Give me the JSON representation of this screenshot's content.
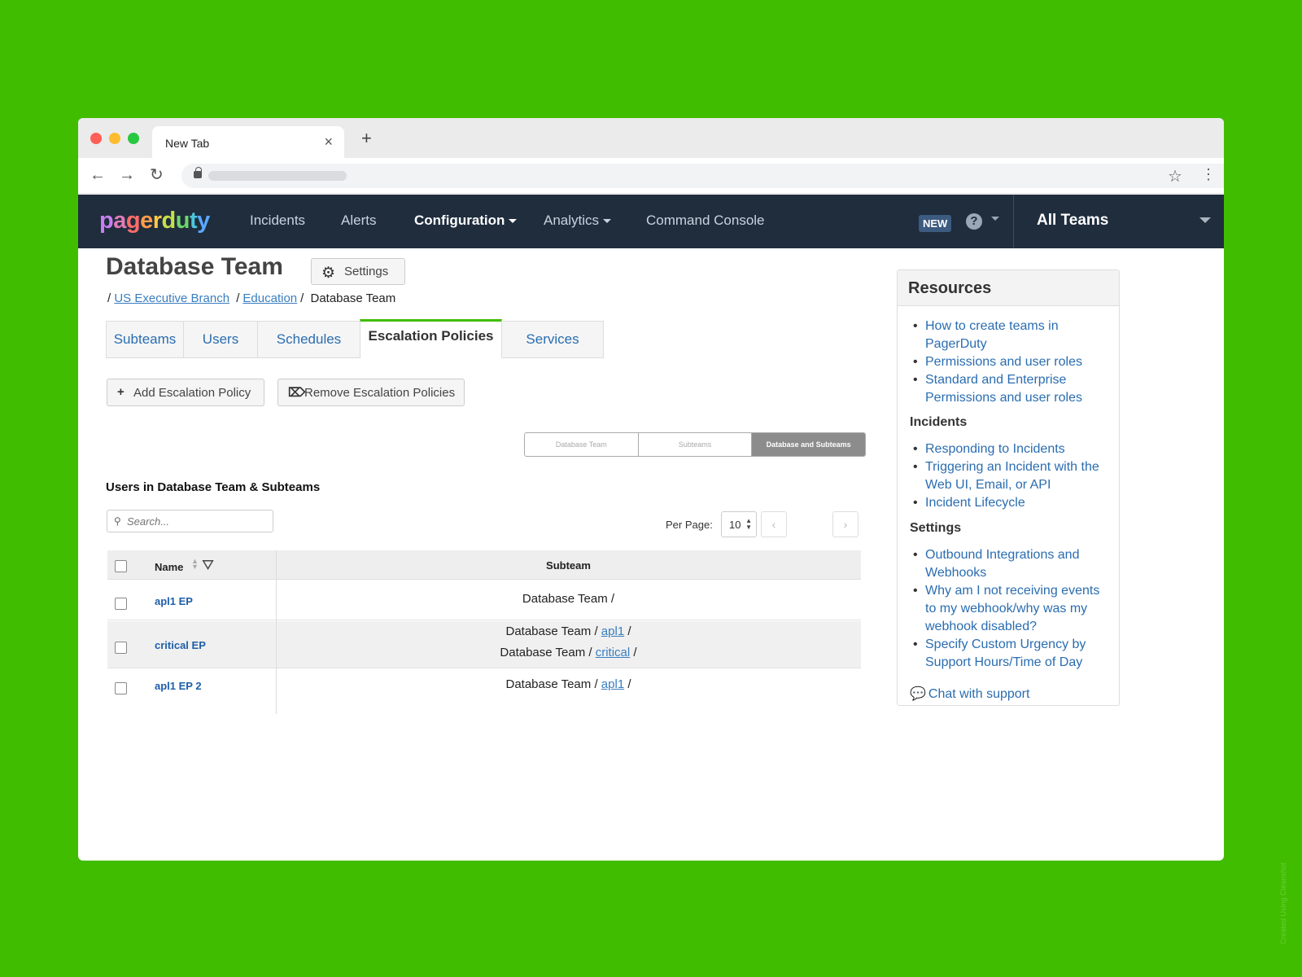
{
  "browser": {
    "tab_title": "New Tab",
    "close_glyph": "×",
    "new_tab_glyph": "+",
    "back_glyph": "←",
    "forward_glyph": "→",
    "reload_glyph": "↻",
    "star_glyph": "☆",
    "menu_glyph": "⋮"
  },
  "header": {
    "logo_letters": [
      "p",
      "a",
      "g",
      "e",
      "r",
      "d",
      "u",
      "t",
      "y"
    ],
    "nav": {
      "incidents": "Incidents",
      "alerts": "Alerts",
      "configuration": "Configuration",
      "analytics": "Analytics",
      "command_console": "Command Console"
    },
    "new_badge": "NEW",
    "help_glyph": "?",
    "teams_selector": "All Teams"
  },
  "page": {
    "title": "Database Team",
    "settings_label": "Settings",
    "settings_icon": "gear-icon",
    "breadcrumb": {
      "sep": "/",
      "item1": "US Executive Branch",
      "item2": "Education",
      "current": "Database Team"
    },
    "tabs": {
      "subteams": "Subteams",
      "users": "Users",
      "schedules": "Schedules",
      "escalation_policies": "Escalation Policies",
      "services": "Services"
    },
    "actions": {
      "add_icon": "+",
      "add_label": "Add Escalation Policy",
      "remove_label": "Remove Escalation Policies"
    },
    "scope": {
      "team": "Database Team",
      "subteams": "Subteams",
      "both": "Database and Subteams",
      "selected": "Database and Subteams"
    },
    "section_title": "Users in Database Team & Subteams",
    "search_placeholder": "Search...",
    "per_page_label": "Per Page:",
    "per_page_value": "10",
    "pager_prev": "‹",
    "pager_next": "›",
    "table": {
      "col_name": "Name",
      "col_subteam": "Subteam",
      "rows": [
        {
          "name": "apl1 EP",
          "lines": [
            {
              "team": "Database Team",
              "link": ""
            }
          ]
        },
        {
          "name": "critical EP",
          "lines": [
            {
              "team": "Database Team",
              "link": "apl1"
            },
            {
              "team": "Database Team",
              "link": "critical"
            }
          ]
        },
        {
          "name": "apl1 EP 2",
          "lines": [
            {
              "team": "Database Team",
              "link": "apl1"
            }
          ]
        }
      ]
    }
  },
  "resources": {
    "title": "Resources",
    "links": [
      "How to create teams in PagerDuty",
      "Permissions and user roles",
      "Standard and Enterprise Permissions and user roles"
    ],
    "incidents_heading": "Incidents",
    "incidents_links": [
      "Responding to Incidents",
      "Triggering an Incident with the Web UI, Email, or API",
      "Incident Lifecycle"
    ],
    "settings_heading": "Settings",
    "settings_links": [
      "Outbound Integrations and Webhooks",
      "Why am I not receiving events to my webhook/why was my webhook disabled?",
      "Specify Custom Urgency by Support Hours/Time of Day"
    ],
    "chat": "Chat with support"
  },
  "watermark": "Created Using Cleanshot",
  "colors": {
    "background": "#41bd00",
    "header": "#1f2d3d",
    "link": "#2a6db0",
    "active_tab_accent": "#41bd00"
  }
}
